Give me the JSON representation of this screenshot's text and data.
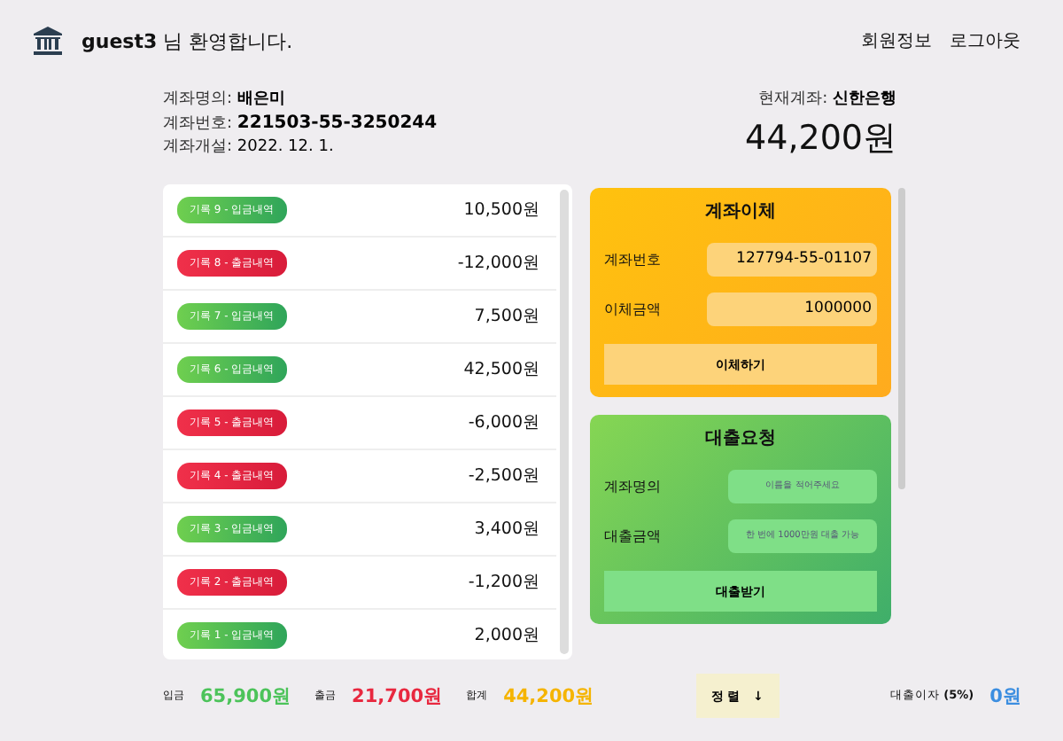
{
  "header": {
    "user": "guest3",
    "greeting": "님 환영합니다.",
    "links": [
      "회원정보",
      "로그아웃"
    ]
  },
  "account": {
    "fields": [
      {
        "label": "계좌명의:",
        "value": "배은미",
        "kind": "name"
      },
      {
        "label": "계좌번호:",
        "value": "221503-55-3250244",
        "kind": "number"
      },
      {
        "label": "계좌개설:",
        "value": "2022. 12. 1.",
        "kind": "date"
      }
    ],
    "current_label": "현재계좌:",
    "bank": "신한은행",
    "balance": "44,200원"
  },
  "transactions": [
    {
      "kind": "deposit",
      "label": "기록 9 - 입금내역",
      "amount": "10,500원"
    },
    {
      "kind": "withdraw",
      "label": "기록 8 - 출금내역",
      "amount": "-12,000원"
    },
    {
      "kind": "deposit",
      "label": "기록 7 - 입금내역",
      "amount": "7,500원"
    },
    {
      "kind": "deposit",
      "label": "기록 6 - 입금내역",
      "amount": "42,500원"
    },
    {
      "kind": "withdraw",
      "label": "기록 5 - 출금내역",
      "amount": "-6,000원"
    },
    {
      "kind": "withdraw",
      "label": "기록 4 - 출금내역",
      "amount": "-2,500원"
    },
    {
      "kind": "deposit",
      "label": "기록 3 - 입금내역",
      "amount": "3,400원"
    },
    {
      "kind": "withdraw",
      "label": "기록 2 - 출금내역",
      "amount": "-1,200원"
    },
    {
      "kind": "deposit",
      "label": "기록 1 - 입금내역",
      "amount": "2,000원"
    }
  ],
  "transfer": {
    "title": "계좌이체",
    "fields": [
      {
        "label": "계좌번호",
        "value": "127794-55-01107"
      },
      {
        "label": "이체금액",
        "value": "1000000"
      }
    ],
    "button": "이체하기"
  },
  "loan": {
    "title": "대출요청",
    "fields": [
      {
        "label": "계좌명의",
        "placeholder": "이름을 적어주세요"
      },
      {
        "label": "대출금액",
        "placeholder": "한 번에 1000만원 대출 가능"
      }
    ],
    "button": "대출받기"
  },
  "summary": {
    "items": [
      {
        "label": "입금",
        "value": "65,900원",
        "color": "#4cc35a"
      },
      {
        "label": "출금",
        "value": "21,700원",
        "color": "#e8283f"
      },
      {
        "label": "합계",
        "value": "44,200원",
        "color": "#f5b400"
      }
    ],
    "sort_button": "정 렬",
    "sort_arrow": "↓",
    "interest_label": "대출이자 **(5%)**",
    "interest_value": "0원"
  }
}
